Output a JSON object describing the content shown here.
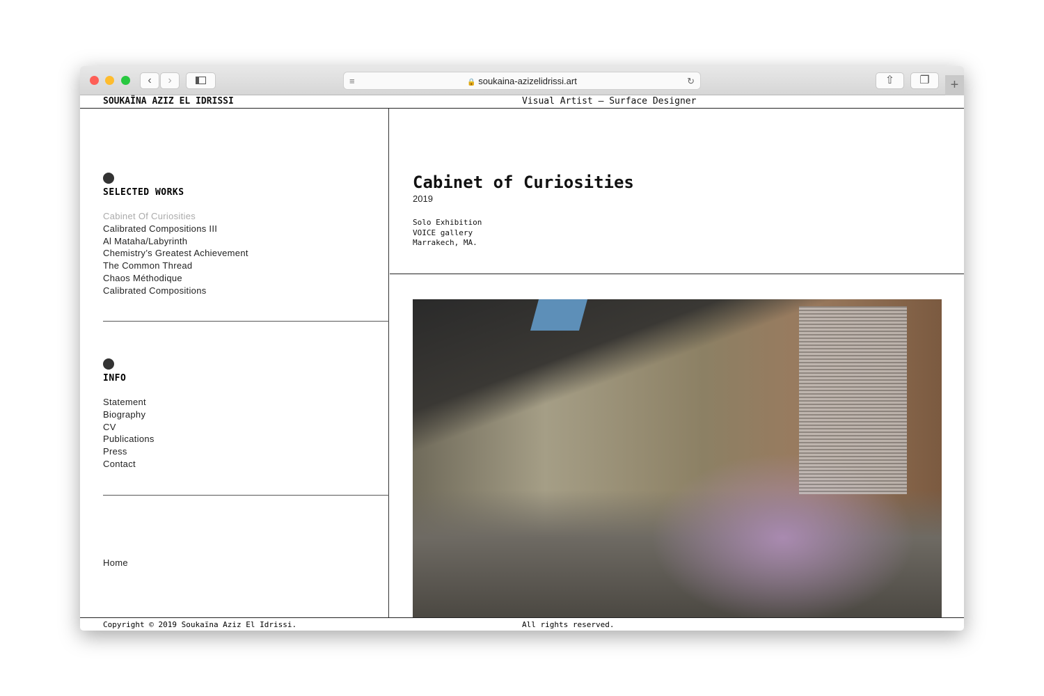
{
  "browser": {
    "url": "soukaina-azizelidrissi.art"
  },
  "header": {
    "site_name": "SOUKAÏNA AZIZ EL IDRISSI",
    "tagline": "Visual Artist – Surface Designer"
  },
  "sidebar": {
    "works_title": "SELECTED WORKS",
    "works": [
      "Cabinet Of Curiosities",
      "Calibrated Compositions III",
      "Al Mataha/Labyrinth",
      "Chemistry’s Greatest Achievement",
      "The Common Thread",
      "Chaos Méthodique",
      "Calibrated Compositions"
    ],
    "info_title": "INFO",
    "info": [
      "Statement",
      "Biography",
      "CV",
      "Publications",
      "Press",
      "Contact"
    ],
    "home": "Home"
  },
  "project": {
    "title": "Cabinet of Curiosities",
    "year": "2019",
    "details": [
      "Solo Exhibition",
      "VOICE gallery",
      "Marrakech, MA."
    ]
  },
  "footer": {
    "copyright": "Copyright © 2019 Soukaïna Aziz El Idrissi.",
    "rights": "All rights reserved."
  }
}
